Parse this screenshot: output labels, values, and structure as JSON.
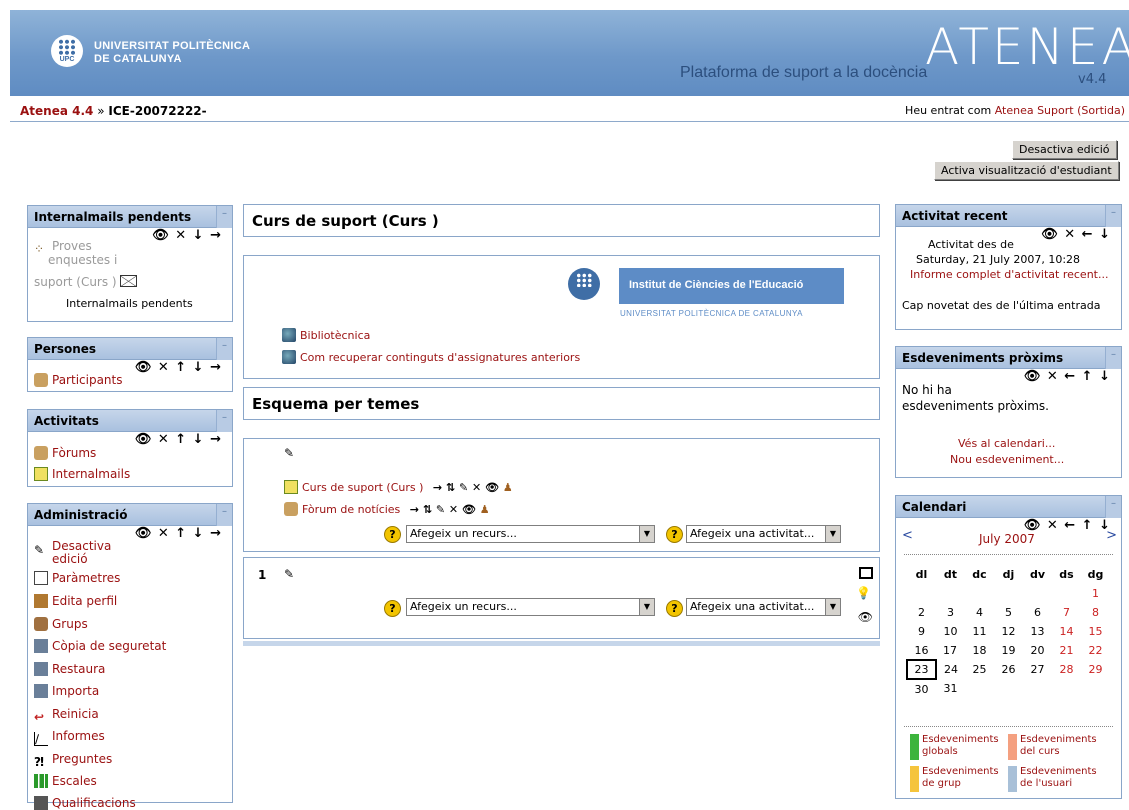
{
  "header": {
    "university_line1": "UNIVERSITAT POLITÈCNICA",
    "university_line2": "DE CATALUNYA",
    "upc_label": "UPC",
    "tagline": "Plataforma de suport a la docència",
    "logo_text": "ATENEA",
    "version": "v4.4"
  },
  "navbar": {
    "home_link": "Atenea 4.4",
    "separator": "»",
    "current": "ICE-20072222-",
    "login_prefix": "Heu entrat com",
    "login_user": "Atenea Suport",
    "logout": "(Sortida)"
  },
  "buttons": {
    "edit_off": "Desactiva edició",
    "student_view": "Activa visualització d'estudiant"
  },
  "left": {
    "internalmails": {
      "title": "Internalmails pendents",
      "item_line1": "Proves",
      "item_line2": "enquestes i",
      "item_line3": "suport (Curs )",
      "footer": "Internalmails pendents"
    },
    "persones": {
      "title": "Persones",
      "participants": "Participants"
    },
    "activitats": {
      "title": "Activitats",
      "forums": "Fòrums",
      "internalmails": "Internalmails"
    },
    "admin": {
      "title": "Administració",
      "items": [
        "Desactiva edició",
        "Paràmetres",
        "Edita perfil",
        "Grups",
        "Còpia de seguretat",
        "Restaura",
        "Importa",
        "Reinicia",
        "Informes",
        "Preguntes",
        "Escales",
        "Qualificacions"
      ]
    }
  },
  "center": {
    "course_title": "Curs de suport (Curs )",
    "ice_name": "Institut de Ciències de l'Educació",
    "ice_subtitle": "UNIVERSITAT POLITÈCNICA DE CATALUNYA",
    "links": [
      "Bibliotècnica",
      "Com recuperar continguts d'assignatures anteriors"
    ],
    "schema_title": "Esquema per temes",
    "section0": {
      "resource1": "Curs de suport (Curs )",
      "resource2": "Fòrum de notícies"
    },
    "section1_number": "1",
    "add_resource": "Afegeix un recurs...",
    "add_activity": "Afegeix una activitat...",
    "help": "?"
  },
  "right": {
    "recent": {
      "title": "Activitat recent",
      "line1": "Activitat des de",
      "line2": "Saturday, 21 July 2007, 10:28",
      "full_report": "Informe complet d'activitat recent...",
      "no_news": "Cap novetat des de l'última entrada"
    },
    "upcoming": {
      "title": "Esdeveniments pròxims",
      "none_line1": "No hi ha",
      "none_line2": "esdeveniments pròxims.",
      "calendar_link": "Vés al calendari...",
      "new_event": "Nou esdeveniment..."
    },
    "calendar": {
      "title": "Calendari",
      "prev": "<",
      "next": ">",
      "month": "July 2007",
      "days": [
        "dl",
        "dt",
        "dc",
        "dj",
        "dv",
        "ds",
        "dg"
      ],
      "weeks": [
        [
          "",
          "",
          "",
          "",
          "",
          "",
          "1"
        ],
        [
          "2",
          "3",
          "4",
          "5",
          "6",
          "7",
          "8"
        ],
        [
          "9",
          "10",
          "11",
          "12",
          "13",
          "14",
          "15"
        ],
        [
          "16",
          "17",
          "18",
          "19",
          "20",
          "21",
          "22"
        ],
        [
          "23",
          "24",
          "25",
          "26",
          "27",
          "28",
          "29"
        ],
        [
          "30",
          "31",
          "",
          "",
          "",
          "",
          ""
        ]
      ],
      "legend": [
        {
          "label": "Esdeveniments globals",
          "color": "#3cb43c"
        },
        {
          "label": "Esdeveniments del curs",
          "color": "#f4a080"
        },
        {
          "label": "Esdeveniments de grup",
          "color": "#f5c43c"
        },
        {
          "label": "Esdeveniments de l'usuari",
          "color": "#a8c0d8"
        }
      ]
    }
  },
  "colors": {
    "header_blue": "#6e98c9",
    "block_head": "#b8cbe4",
    "link": "#9a1010"
  }
}
